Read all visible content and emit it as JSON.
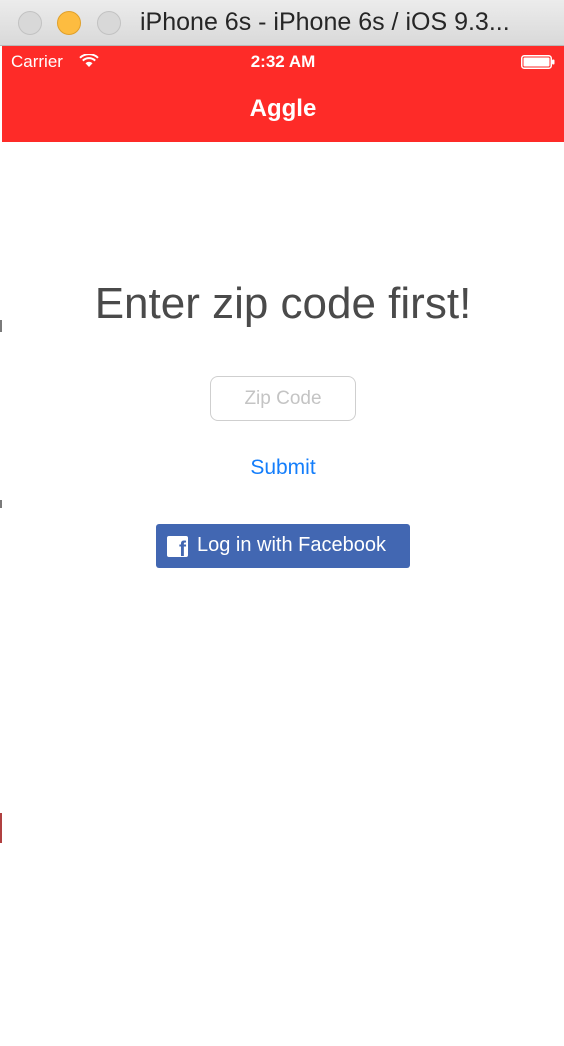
{
  "window": {
    "title": "iPhone 6s - iPhone 6s / iOS 9.3..."
  },
  "status_bar": {
    "carrier": "Carrier",
    "time": "2:32 AM",
    "wifi_icon": "wifi-icon",
    "battery_icon": "battery-icon"
  },
  "nav_bar": {
    "title": "Aggle",
    "color": "#fe2b28"
  },
  "main": {
    "heading": "Enter zip code first!",
    "zip_input": {
      "value": "",
      "placeholder": "Zip Code"
    },
    "submit_label": "Submit",
    "facebook_button": {
      "label": "Log in with Facebook",
      "icon": "facebook-icon",
      "color": "#4267b2"
    }
  }
}
